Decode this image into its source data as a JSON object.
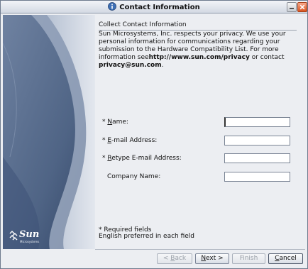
{
  "window": {
    "title": "Contact Information"
  },
  "branding": {
    "logo_text": "Sun",
    "logo_tagline": "Microsystems"
  },
  "content": {
    "heading": "Collect Contact Information",
    "paragraph_text": "Sun Microsystems, Inc. respects your privacy. We use your personal information for communications regarding your submission to the Hardware Compatibility List. For more information see",
    "privacy_url": "http://www.sun.com/privacy",
    "paragraph_or": " or contact ",
    "contact_email": "privacy@sun.com",
    "paragraph_end": "."
  },
  "form": {
    "fields": [
      {
        "required_mark": "* ",
        "label_mnemonic": "N",
        "label_rest": "ame:",
        "value": ""
      },
      {
        "required_mark": "* ",
        "label_mnemonic": "E",
        "label_rest": "-mail Address:",
        "value": ""
      },
      {
        "required_mark": "* ",
        "label_mnemonic": "R",
        "label_rest": "etype E-mail Address:",
        "value": ""
      },
      {
        "required_mark": "",
        "label_mnemonic": "",
        "label_rest": "Company Name:",
        "value": ""
      }
    ]
  },
  "notes": {
    "required": "* Required fields",
    "language": "English preferred in each field"
  },
  "buttons": {
    "back_prefix": "< ",
    "back_mnemonic": "B",
    "back_rest": "ack",
    "next_mnemonic": "N",
    "next_rest": "ext >",
    "finish": "Finish",
    "cancel_mnemonic": "C",
    "cancel_rest": "ancel"
  },
  "colors": {
    "panel_dark": "#5d7190",
    "panel_light": "#c3cbd8",
    "close_button": "#d9531e"
  }
}
